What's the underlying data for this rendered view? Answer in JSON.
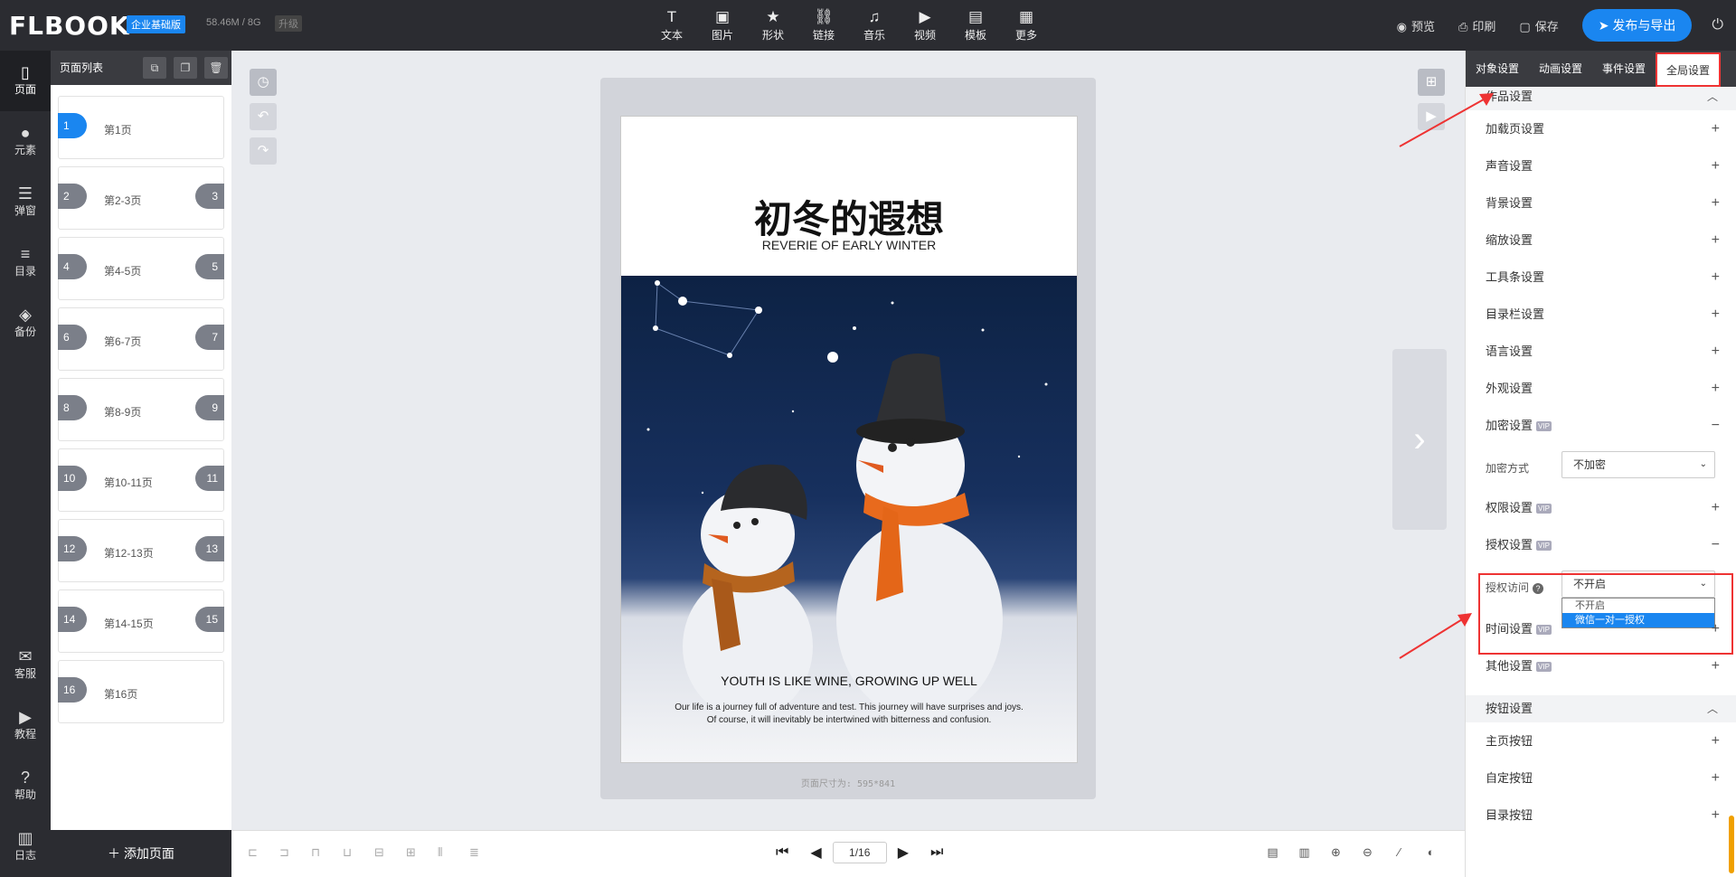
{
  "topbar": {
    "logo": "FLBOOK",
    "edition_badge": "企业基础版",
    "storage": "58.46M / 8G",
    "upgrade": "升级",
    "tools": [
      {
        "icon": "text-icon",
        "label": "文本"
      },
      {
        "icon": "image-icon",
        "label": "图片"
      },
      {
        "icon": "shape-icon",
        "label": "形状"
      },
      {
        "icon": "link-icon",
        "label": "链接"
      },
      {
        "icon": "music-icon",
        "label": "音乐"
      },
      {
        "icon": "video-icon",
        "label": "视频"
      },
      {
        "icon": "template-icon",
        "label": "模板"
      },
      {
        "icon": "more-icon",
        "label": "更多"
      }
    ],
    "preview": "预览",
    "print": "印刷",
    "save": "保存",
    "publish": "发布与导出"
  },
  "leftnav": {
    "items": [
      {
        "icon": "page-icon",
        "label": "页面"
      },
      {
        "icon": "element-icon",
        "label": "元素"
      },
      {
        "icon": "popup-icon",
        "label": "弹窗"
      },
      {
        "icon": "toc-icon",
        "label": "目录"
      },
      {
        "icon": "backup-icon",
        "label": "备份"
      }
    ],
    "bottom": [
      {
        "icon": "service-icon",
        "label": "客服"
      },
      {
        "icon": "tutorial-icon",
        "label": "教程"
      },
      {
        "icon": "help-icon",
        "label": "帮助"
      },
      {
        "icon": "log-icon",
        "label": "日志"
      }
    ]
  },
  "pages": {
    "title": "页面列表",
    "items": [
      {
        "left": "1",
        "right": "",
        "label": "第1页"
      },
      {
        "left": "2",
        "right": "3",
        "label": "第2-3页"
      },
      {
        "left": "4",
        "right": "5",
        "label": "第4-5页"
      },
      {
        "left": "6",
        "right": "7",
        "label": "第6-7页"
      },
      {
        "left": "8",
        "right": "9",
        "label": "第8-9页"
      },
      {
        "left": "10",
        "right": "11",
        "label": "第10-11页"
      },
      {
        "left": "12",
        "right": "13",
        "label": "第12-13页"
      },
      {
        "left": "14",
        "right": "15",
        "label": "第14-15页"
      },
      {
        "left": "16",
        "right": "",
        "label": "第16页"
      }
    ],
    "add_label": "添加页面"
  },
  "canvas": {
    "title": "初冬的遐想",
    "subtitle": "REVERIE OF EARLY WINTER",
    "headline": "YOUTH IS LIKE WINE, GROWING UP WELL",
    "body_line1": "Our life is a journey full of adventure and test. This journey will have surprises and joys.",
    "body_line2": "Of course, it will inevitably be intertwined with bitterness and confusion.",
    "size_hint": "页面尺寸为: 595*841"
  },
  "pager": {
    "current": "1/16"
  },
  "rightpanel": {
    "tabs": [
      "对象设置",
      "动画设置",
      "事件设置",
      "全局设置"
    ],
    "section1": "作品设置",
    "rows_a": [
      "加载页设置",
      "声音设置",
      "背景设置",
      "缩放设置",
      "工具条设置",
      "目录栏设置",
      "语言设置",
      "外观设置"
    ],
    "encrypt": "加密设置",
    "encrypt_mode_label": "加密方式",
    "encrypt_mode_value": "不加密",
    "permission": "权限设置",
    "auth": "授权设置",
    "auth_access_label": "授权访问",
    "auth_access_value": "不开启",
    "auth_options": [
      "不开启",
      "微信一对一授权"
    ],
    "time": "时间设置",
    "other": "其他设置",
    "section2": "按钮设置",
    "rows_b": [
      "主页按钮",
      "自定按钮",
      "目录按钮"
    ],
    "vip": "VIP"
  }
}
